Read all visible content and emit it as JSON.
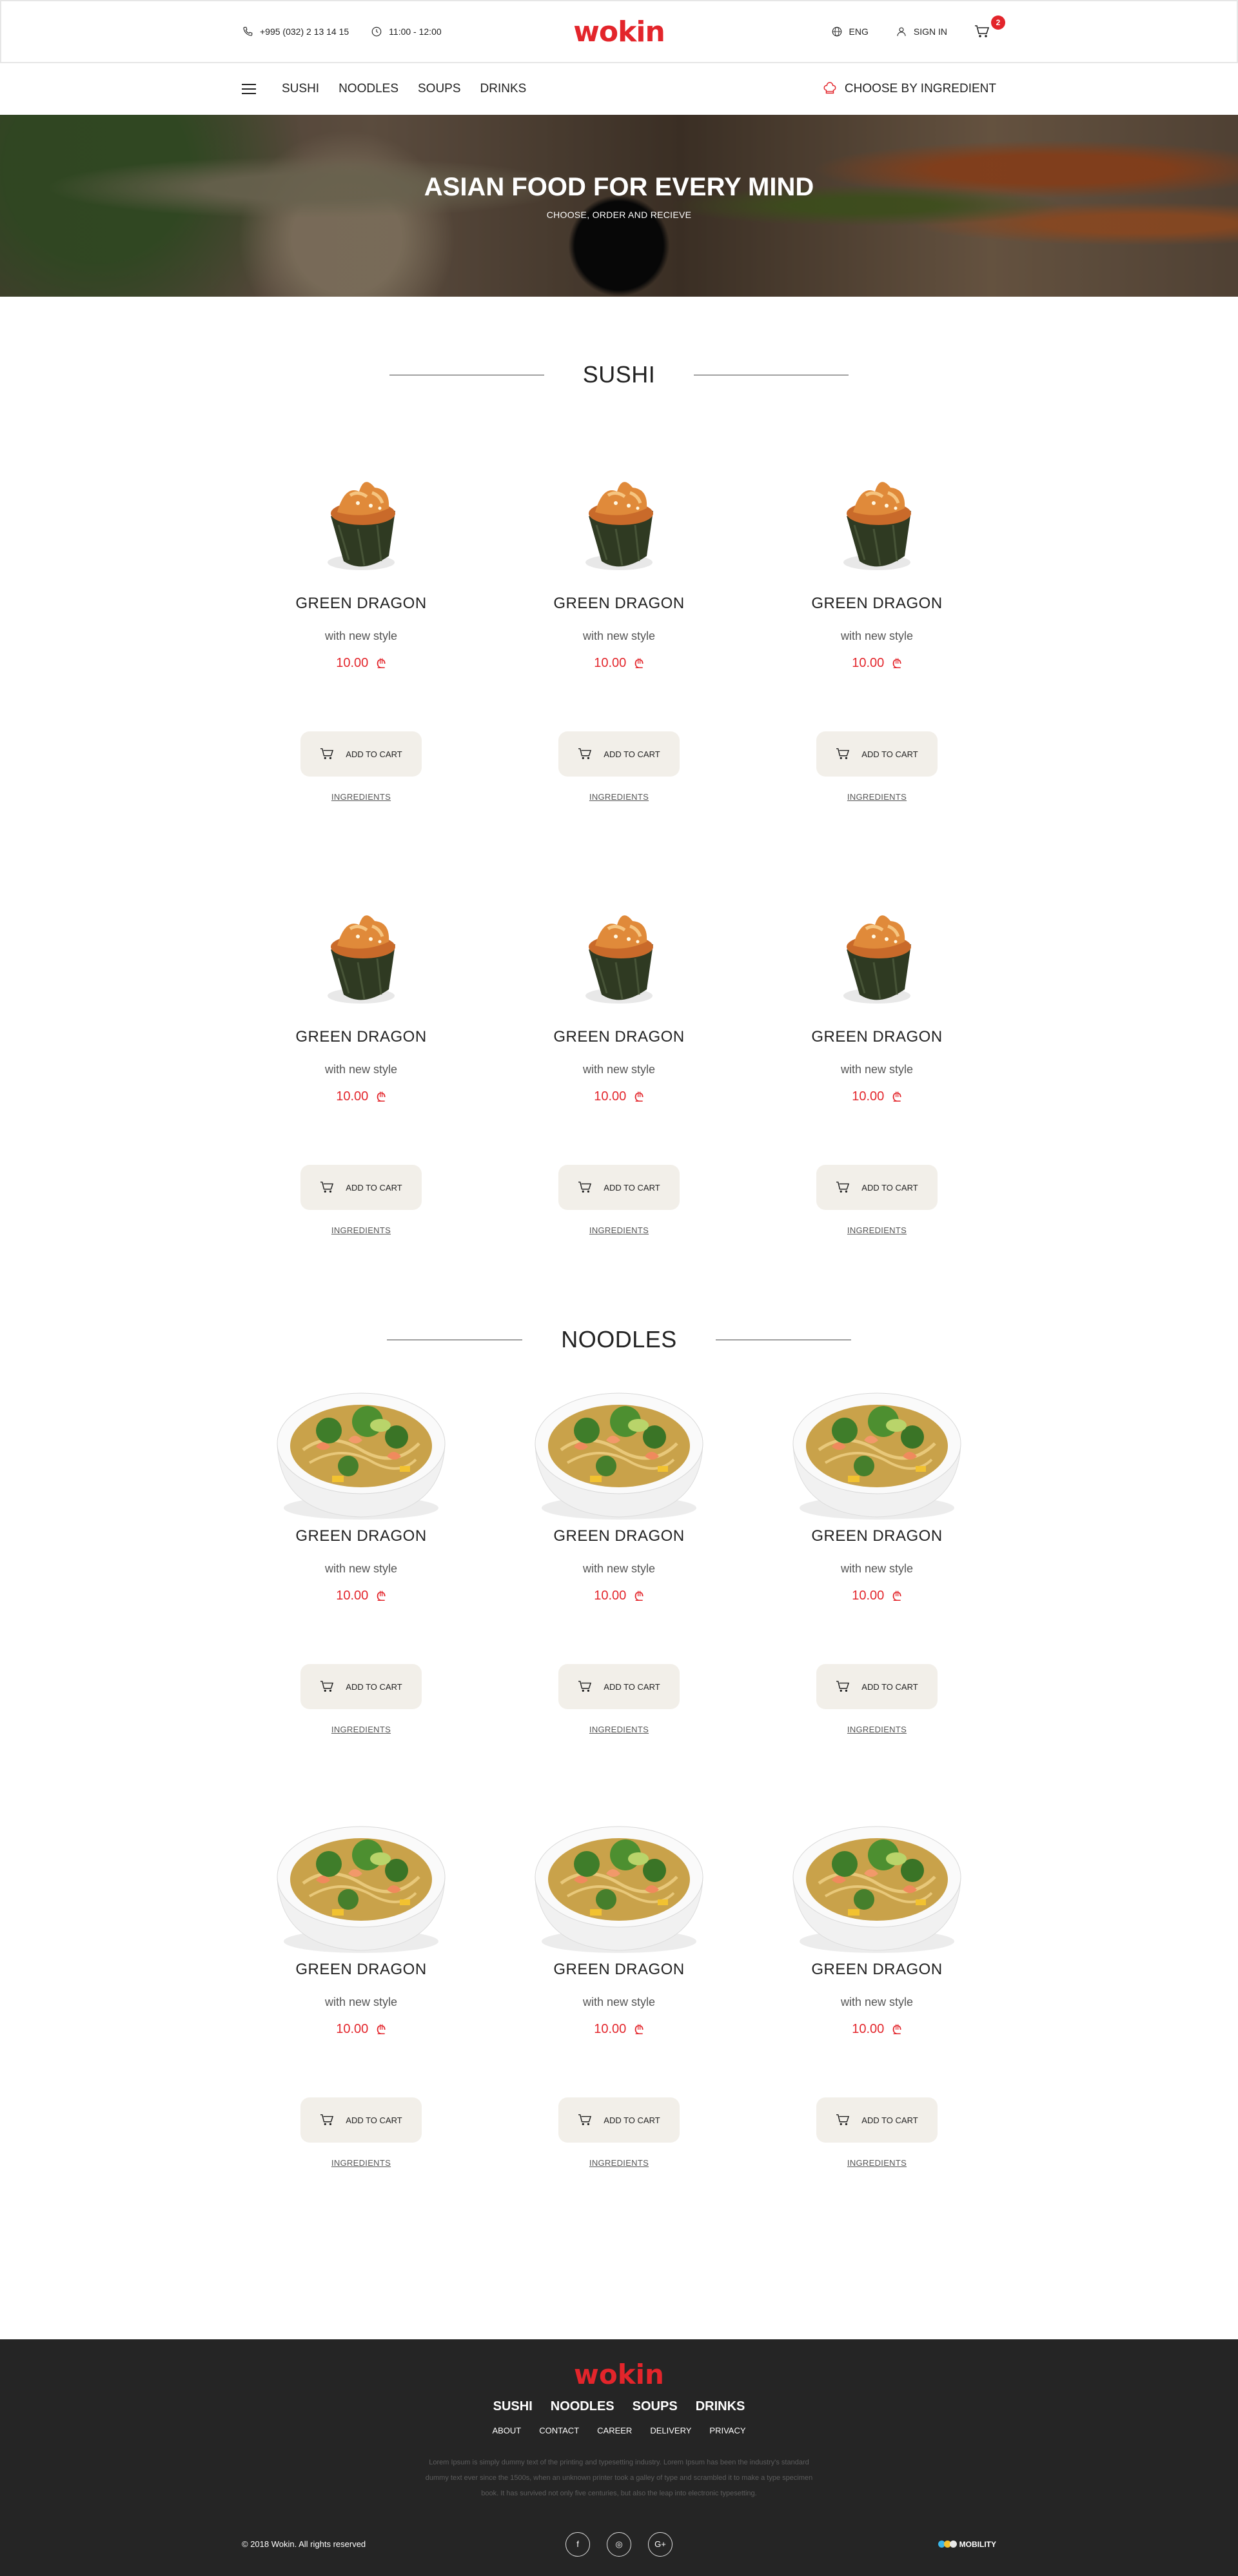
{
  "topbar": {
    "phone": "+995 (032) 2 13 14 15",
    "hours": "11:00 - 12:00",
    "logo": "wokin",
    "language": "ENG",
    "signin": "SIGN IN",
    "cart_count": "2"
  },
  "nav": {
    "items": [
      "SUSHI",
      "NOODLES",
      "SOUPS",
      "DRINKS"
    ],
    "choose": "CHOOSE BY INGREDIENT"
  },
  "hero": {
    "title": "ASIAN FOOD FOR EVERY MIND",
    "subtitle": "CHOOSE, ORDER AND RECIEVE"
  },
  "sections": [
    {
      "title": "SUSHI",
      "products": [
        {
          "name": "GREEN DRAGON",
          "desc": "with new style",
          "price": "10.00"
        },
        {
          "name": "GREEN DRAGON",
          "desc": "with new style",
          "price": "10.00"
        },
        {
          "name": "GREEN DRAGON",
          "desc": "with new style",
          "price": "10.00"
        },
        {
          "name": "GREEN DRAGON",
          "desc": "with new style",
          "price": "10.00"
        },
        {
          "name": "GREEN DRAGON",
          "desc": "with new style",
          "price": "10.00"
        },
        {
          "name": "GREEN DRAGON",
          "desc": "with new style",
          "price": "10.00"
        }
      ]
    },
    {
      "title": "NOODLES",
      "products": [
        {
          "name": "GREEN DRAGON",
          "desc": "with new style",
          "price": "10.00"
        },
        {
          "name": "GREEN DRAGON",
          "desc": "with new style",
          "price": "10.00"
        },
        {
          "name": "GREEN DRAGON",
          "desc": "with new style",
          "price": "10.00"
        },
        {
          "name": "GREEN DRAGON",
          "desc": "with new style",
          "price": "10.00"
        },
        {
          "name": "GREEN DRAGON",
          "desc": "with new style",
          "price": "10.00"
        },
        {
          "name": "GREEN DRAGON",
          "desc": "with new style",
          "price": "10.00"
        }
      ]
    }
  ],
  "card": {
    "add_to_cart": "ADD TO CART",
    "ingredients": "INGREDIENTS",
    "currency": "₾"
  },
  "footer": {
    "logo": "wokin",
    "categories": [
      "SUSHI",
      "NOODLES",
      "SOUPS",
      "DRINKS"
    ],
    "links": [
      "ABOUT",
      "CONTACT",
      "CAREER",
      "DELIVERY",
      "PRIVACY"
    ],
    "text": "Lorem Ipsum is simply dummy text of the printing and typesetting industry. Lorem Ipsum has been the industry's standard dummy text ever since the 1500s, when an unknown printer took a galley of type and scrambled it to make a type specimen book. It has survived not only five centuries, but also the leap into electronic typesetting.",
    "copyright": "© 2018 Wokin. All rights reserved",
    "social": [
      "f",
      "◎",
      "G+"
    ],
    "credit": "MOBILITY"
  },
  "colors": {
    "accent": "#e3252b",
    "button_bg": "#f2efe9",
    "footer_bg": "#252525"
  }
}
